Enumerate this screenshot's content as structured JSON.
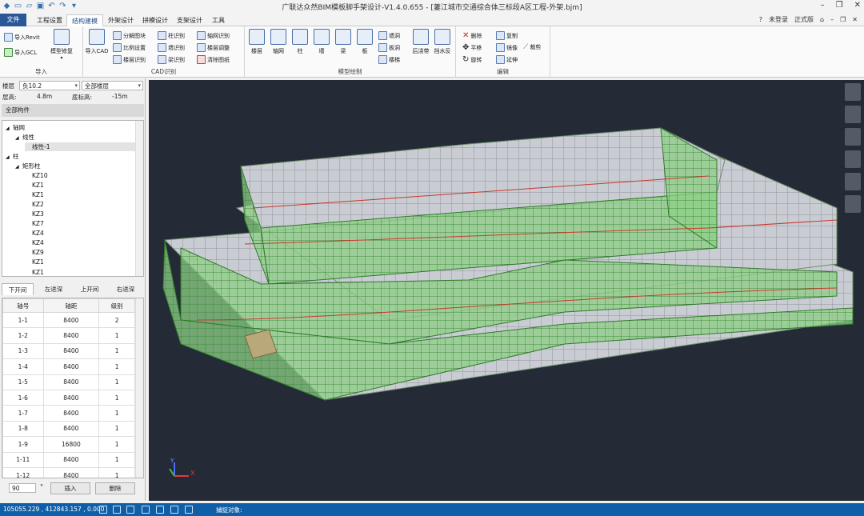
{
  "app": {
    "title": "广联达众然BIM模板脚手架设计-V1.4.0.655 - [萋江城市交通综合体三标段A区工程-外架.bjm]"
  },
  "menu": {
    "file": "文件",
    "tabs": [
      "工程设置",
      "结构建模",
      "外架设计",
      "拼模设计",
      "支架设计",
      "工具"
    ],
    "active_tab": "结构建模",
    "right": {
      "help": "?",
      "login": "未登录",
      "edition": "正式版"
    }
  },
  "ribbon": {
    "import": {
      "label": "导入",
      "revit": "导入Revit",
      "gcl": "导入GCL",
      "repair": "模型修复"
    },
    "cad": {
      "label": "CAD识别",
      "import_cad": "导入CAD",
      "col1": [
        "分解图块",
        "比例设置",
        "楼层识别"
      ],
      "col2": [
        "柱识别",
        "墙识别",
        "梁识别"
      ],
      "col3": [
        "轴网识别",
        "楼层调整",
        "清除图纸"
      ]
    },
    "model": {
      "label": "模型绘制",
      "buttons": [
        "楼层",
        "轴网",
        "柱",
        "墙",
        "梁",
        "板"
      ],
      "small": [
        "墙洞",
        "板洞",
        "楼梯"
      ],
      "post": [
        "后浇带",
        "挡水反"
      ]
    },
    "edit": {
      "label": "编辑",
      "col1": [
        "删除",
        "平移",
        "旋转"
      ],
      "col2": [
        "复制",
        "镜像",
        "延伸"
      ],
      "col3": [
        "裁剪"
      ]
    }
  },
  "floor": {
    "label": "楼层",
    "value": "负10.2",
    "scope": "全部楼层",
    "height_label": "层高:",
    "height": "4.8m",
    "base_label": "底标高:",
    "base": "-15m"
  },
  "tree": {
    "header": "全部构件",
    "nodes": [
      {
        "text": "轴网",
        "level": 0,
        "expander": "◢"
      },
      {
        "text": "线性",
        "level": 1,
        "expander": "◢"
      },
      {
        "text": "线性-1",
        "level": 2,
        "expander": ""
      },
      {
        "text": "柱",
        "level": 0,
        "expander": "◢"
      },
      {
        "text": "矩形柱",
        "level": 1,
        "expander": "◢"
      },
      {
        "text": "KZ10",
        "level": 2,
        "expander": ""
      },
      {
        "text": "KZ1",
        "level": 2,
        "expander": ""
      },
      {
        "text": "KZ1",
        "level": 2,
        "expander": ""
      },
      {
        "text": "KZ2",
        "level": 2,
        "expander": ""
      },
      {
        "text": "KZ3",
        "level": 2,
        "expander": ""
      },
      {
        "text": "KZ7",
        "level": 2,
        "expander": ""
      },
      {
        "text": "KZ4",
        "level": 2,
        "expander": ""
      },
      {
        "text": "KZ4",
        "level": 2,
        "expander": ""
      },
      {
        "text": "KZ9",
        "level": 2,
        "expander": ""
      },
      {
        "text": "KZ1",
        "level": 2,
        "expander": ""
      },
      {
        "text": "KZ1",
        "level": 2,
        "expander": ""
      }
    ]
  },
  "bay_tabs": [
    "下开间",
    "左进深",
    "上开间",
    "右进深"
  ],
  "bay_table": {
    "headers": [
      "轴号",
      "轴距",
      "级别"
    ],
    "rows": [
      [
        "1-1",
        "8400",
        "2"
      ],
      [
        "1-2",
        "8400",
        "1"
      ],
      [
        "1-3",
        "8400",
        "1"
      ],
      [
        "1-4",
        "8400",
        "1"
      ],
      [
        "1-5",
        "8400",
        "1"
      ],
      [
        "1-6",
        "8400",
        "1"
      ],
      [
        "1-7",
        "8400",
        "1"
      ],
      [
        "1-8",
        "8400",
        "1"
      ],
      [
        "1-9",
        "16800",
        "1"
      ],
      [
        "1-11",
        "8400",
        "1"
      ],
      [
        "1-12",
        "8400",
        "1"
      ]
    ]
  },
  "bottom_controls": {
    "angle": "90",
    "degree": "°",
    "insert": "插入",
    "delete": "删除"
  },
  "status": {
    "coords": "105055.229 , 412843.157 , 0.000",
    "snap": "捕捉对象:"
  },
  "viewport": {
    "axis_x": "X",
    "axis_y": "Y",
    "colors": {
      "background": "#242a36",
      "scaffold": "#7fd17a",
      "floor": "#c9ccd2",
      "rail": "#c83a2f"
    }
  }
}
